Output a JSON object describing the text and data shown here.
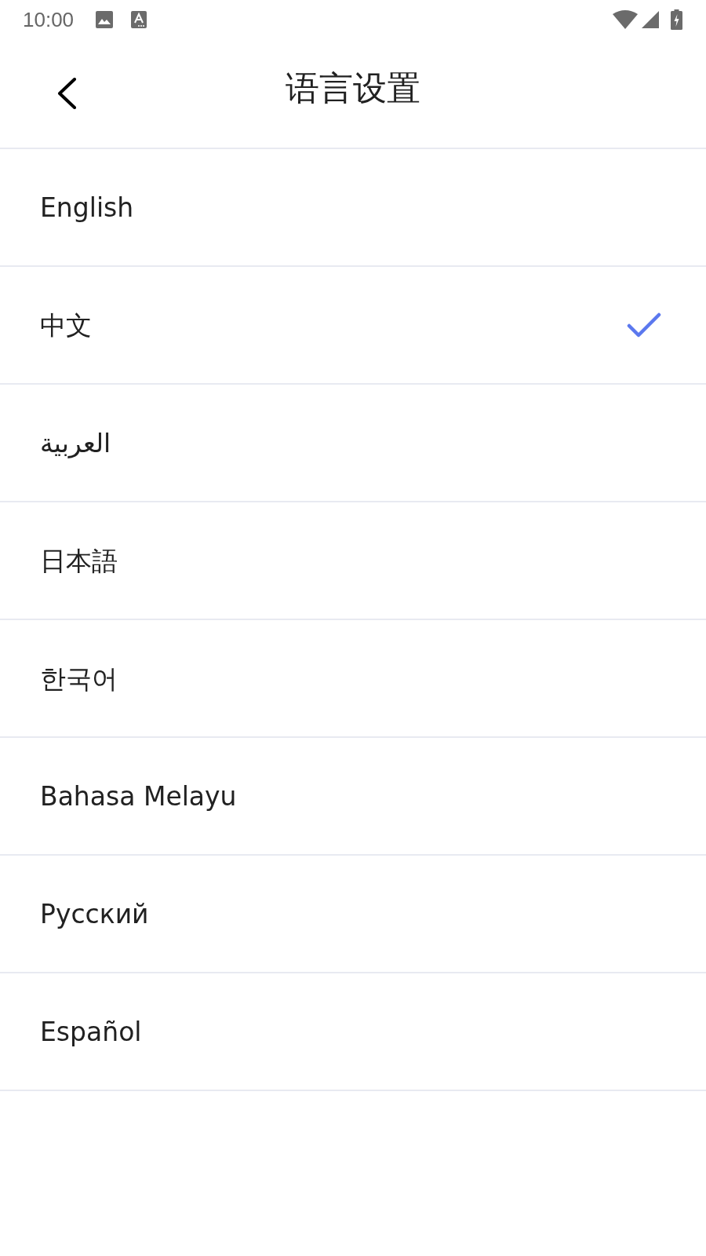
{
  "status_bar": {
    "time": "10:00"
  },
  "header": {
    "title": "语言设置"
  },
  "languages": [
    {
      "label": "English",
      "selected": false
    },
    {
      "label": "中文",
      "selected": true
    },
    {
      "label": "العربية",
      "selected": false
    },
    {
      "label": "日本語",
      "selected": false
    },
    {
      "label": "한국어",
      "selected": false
    },
    {
      "label": "Bahasa Melayu",
      "selected": false
    },
    {
      "label": "Русский",
      "selected": false
    },
    {
      "label": "Español",
      "selected": false
    }
  ]
}
